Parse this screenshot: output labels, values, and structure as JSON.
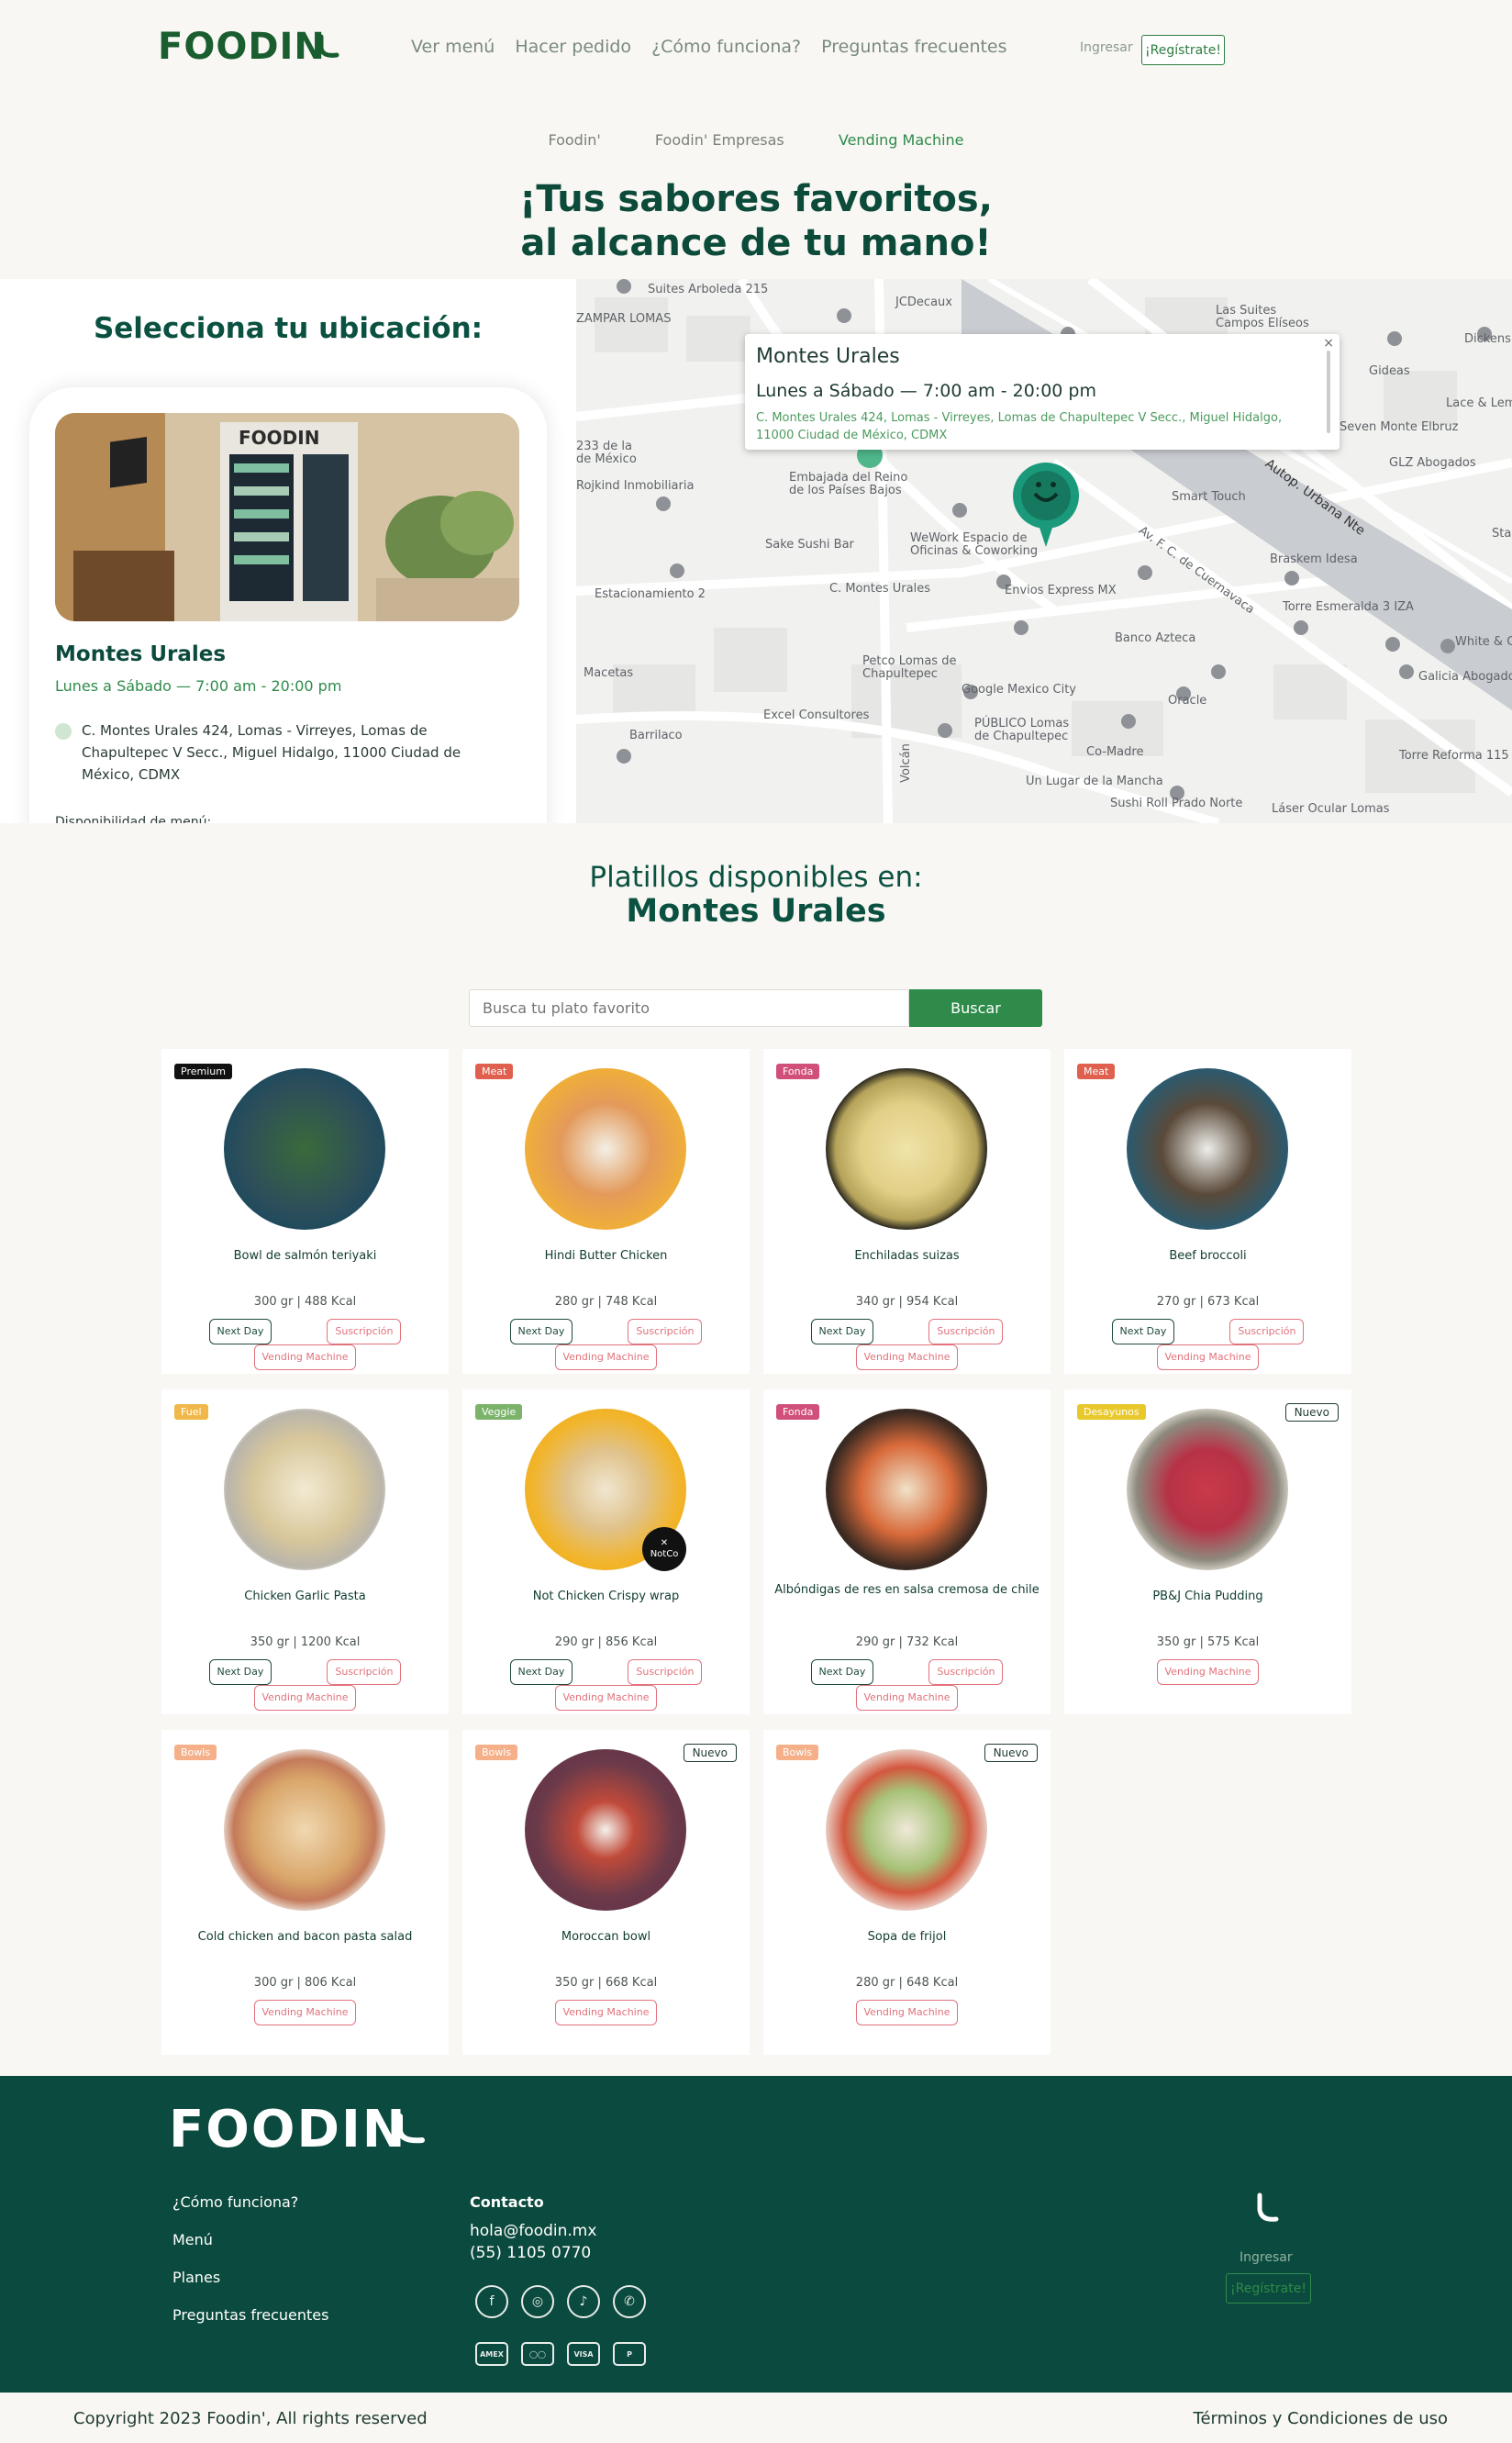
{
  "header": {
    "logo": "FOODIN",
    "nav": [
      "Ver menú",
      "Hacer pedido",
      "¿Cómo funciona?",
      "Preguntas frecuentes"
    ],
    "login": "Ingresar",
    "register": "¡Regístrate!"
  },
  "subnav": [
    "Foodin'",
    "Foodin' Empresas",
    "Vending Machine"
  ],
  "hero": {
    "line1": "¡Tus sabores favoritos,",
    "line2": "al alcance de tu mano!"
  },
  "location": {
    "heading": "Selecciona tu ubicación:",
    "name": "Montes Urales",
    "hours": "Lunes a Sábado — 7:00 am - 20:00 pm",
    "address": "C. Montes Urales 424, Lomas - Virreyes, Lomas de Chapultepec V Secc., Miguel Hidalgo, 11000 Ciudad de México, CDMX",
    "menu_availability": "Disponibilidad de menú:"
  },
  "map": {
    "popup_title": "Montes Urales",
    "popup_hours": "Lunes a Sábado — 7:00 am - 20:00 pm",
    "popup_address": "C. Montes Urales 424, Lomas - Virreyes, Lomas de Chapultepec V Secc., Miguel Hidalgo, 11000 Ciudad de México, CDMX",
    "close": "×",
    "labels": [
      "Suites Arboleda 215",
      "JCDecaux",
      "Las Suites Campos Elíseos",
      "Dickens",
      "ZAMPAR LOMAS",
      "Gideas",
      "Lace & Lem",
      "Seven Monte Elbruz",
      "GLZ Abogados",
      "Smart Touch",
      "233 de la de México",
      "Rojkind Inmobiliaria",
      "Embajada del Reino de los Países Bajos",
      "Sake Sushi Bar",
      "WeWork Espacio de Oficinas & Coworking",
      "Braskem Idesa",
      "Torre Esmeralda 3 IZA",
      "Estacionamiento 2",
      "C. Montes Urales",
      "Envios Express MX",
      "Banco Azteca",
      "White & C",
      "Galicia Abogado",
      "Macetas",
      "Petco Lomas de Chapultepec",
      "Google Mexico City",
      "Oracle",
      "Excel Consultores",
      "PÚBLICO Lomas de Chapultepec",
      "Co-Madre",
      "Barrilaco",
      "Torre Reforma 115",
      "Un Lugar de la Mancha",
      "Sushi Roll Prado Norte",
      "Láser Ocular Lomas",
      "Volcán",
      "Autop. Urbana Nte",
      "Av. F. C. de Cuernavaca",
      "Sta"
    ]
  },
  "dishes_heading": {
    "line1": "Platillos disponibles en:",
    "line2": "Montes Urales"
  },
  "search": {
    "placeholder": "Busca tu plato favorito",
    "button": "Buscar"
  },
  "dishes": [
    {
      "badge": "Premium",
      "name": "Bowl de salmón teriyaki",
      "info": "300 gr | 488 Kcal",
      "next_day": "Next Day",
      "subscription": "Suscripción",
      "vending": "Vending Machine"
    },
    {
      "badge": "Meat",
      "name": "Hindi Butter Chicken",
      "info": "280 gr | 748 Kcal",
      "next_day": "Next Day",
      "subscription": "Suscripción",
      "vending": "Vending Machine"
    },
    {
      "badge": "Fonda",
      "name": "Enchiladas suizas",
      "info": "340 gr | 954 Kcal",
      "next_day": "Next Day",
      "subscription": "Suscripción",
      "vending": "Vending Machine"
    },
    {
      "badge": "Meat",
      "name": "Beef broccoli",
      "info": "270 gr | 673 Kcal",
      "next_day": "Next Day",
      "subscription": "Suscripción",
      "vending": "Vending Machine"
    },
    {
      "badge": "Fuel",
      "name": "Chicken Garlic Pasta",
      "info": "350 gr | 1200 Kcal",
      "next_day": "Next Day",
      "subscription": "Suscripción",
      "vending": "Vending Machine"
    },
    {
      "badge": "Veggie",
      "name": "Not Chicken Crispy wrap",
      "info": "290 gr | 856 Kcal",
      "next_day": "Next Day",
      "subscription": "Suscripción",
      "vending": "Vending Machine",
      "partner": "NotCo"
    },
    {
      "badge": "Fonda",
      "name": "Albóndigas de res en salsa cremosa de chile",
      "info": "290 gr | 732 Kcal",
      "next_day": "Next Day",
      "subscription": "Suscripción",
      "vending": "Vending Machine"
    },
    {
      "badge": "Desayunos",
      "nuevo": "Nuevo",
      "name": "PB&J Chia Pudding",
      "info": "350 gr | 575 Kcal",
      "vending": "Vending Machine"
    },
    {
      "badge": "Bowls",
      "name": "Cold chicken and bacon pasta salad",
      "info": "300 gr | 806 Kcal",
      "vending": "Vending Machine"
    },
    {
      "badge": "Bowls",
      "nuevo": "Nuevo",
      "name": "Moroccan bowl",
      "info": "350 gr | 668 Kcal",
      "vending": "Vending Machine"
    },
    {
      "badge": "Bowls",
      "nuevo": "Nuevo",
      "name": "Sopa de frijol",
      "info": "280 gr | 648 Kcal",
      "vending": "Vending Machine"
    }
  ],
  "badge_colors": {
    "Premium": "#111111",
    "Meat": "#e0604f",
    "Fonda": "#d0507a",
    "Fuel": "#f0b84a",
    "Veggie": "#7cb36b",
    "Desayunos": "#e8c82a",
    "Bowls": "#f5b08a"
  },
  "footer": {
    "logo": "FOODIN",
    "links": [
      "¿Cómo funciona?",
      "Menú",
      "Planes",
      "Preguntas frecuentes"
    ],
    "contact_heading": "Contacto",
    "email": "hola@foodin.mx",
    "phone": "(55) 1105 0770",
    "social": [
      "facebook-icon",
      "instagram-icon",
      "tiktok-icon",
      "whatsapp-icon"
    ],
    "payments": [
      "AMEX",
      "mastercard-icon",
      "VISA",
      "paypal-icon"
    ],
    "login": "Ingresar",
    "register": "¡Regístrate!"
  },
  "bottom": {
    "copyright": "Copyright 2023 Foodin', All rights reserved",
    "terms": "Términos y Condiciones de uso"
  }
}
